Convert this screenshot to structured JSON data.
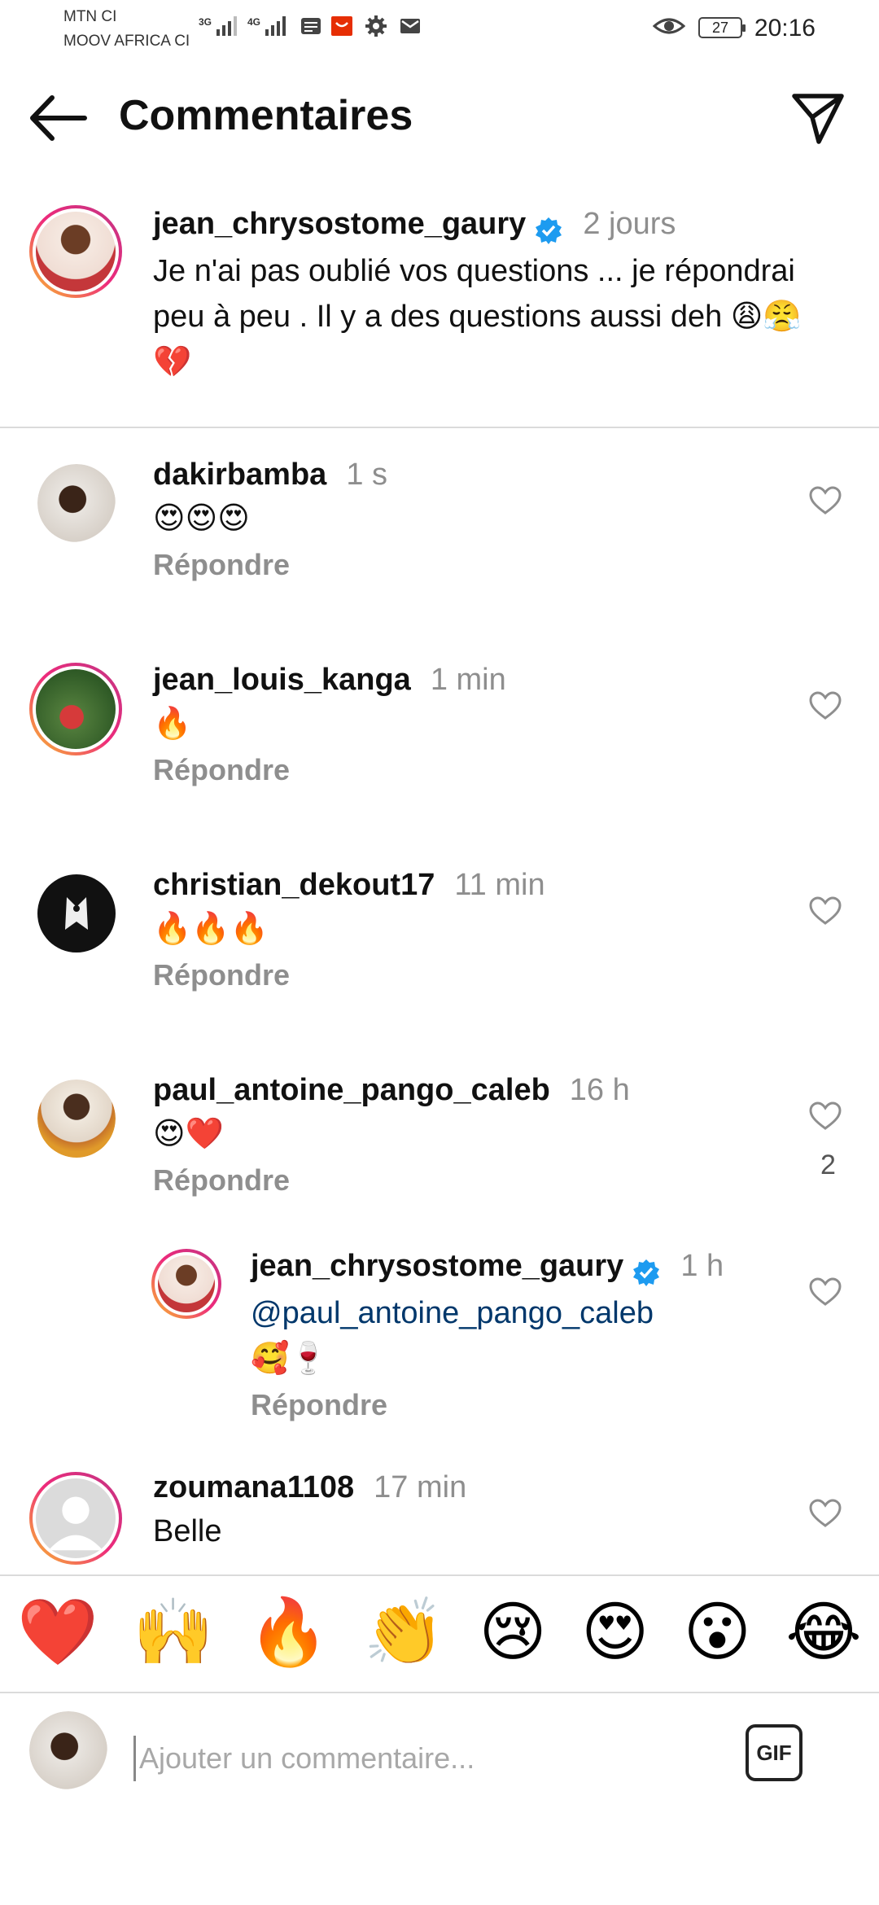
{
  "status_bar": {
    "carrier1": "MTN CI",
    "carrier2": "MOOV AFRICA CI",
    "net1": "3G",
    "net2": "4G",
    "battery": "27",
    "time": "20:16"
  },
  "header": {
    "title": "Commentaires"
  },
  "caption": {
    "username": "jean_chrysostome_gaury",
    "time": "2 jours",
    "text": "Je n'ai pas oublié vos questions ... je répondrai peu à peu . Il y a des questions aussi deh 😩😤💔"
  },
  "comments": [
    {
      "username": "dakirbamba",
      "time": "1 s",
      "text": "😍😍😍",
      "reply": "Répondre"
    },
    {
      "username": "jean_louis_kanga",
      "time": "1 min",
      "text": "🔥",
      "reply": "Répondre"
    },
    {
      "username": "christian_dekout17",
      "time": "11 min",
      "text": "🔥🔥🔥",
      "reply": "Répondre"
    },
    {
      "username": "paul_antoine_pango_caleb",
      "time": "16 h",
      "text": "😍❤️",
      "reply": "Répondre",
      "likes": "2"
    }
  ],
  "nested_reply": {
    "username": "jean_chrysostome_gaury",
    "time": "1 h",
    "mention": "@paul_antoine_pango_caleb",
    "text": "🥰🍷",
    "reply": "Répondre"
  },
  "last_comment": {
    "username": "zoumana1108",
    "time": "17 min",
    "text": "Belle"
  },
  "reactions": [
    "❤️",
    "🙌",
    "🔥",
    "👏",
    "😢",
    "😍",
    "😮",
    "😂"
  ],
  "input": {
    "placeholder": "Ajouter un commentaire...",
    "gif_label": "GIF"
  }
}
